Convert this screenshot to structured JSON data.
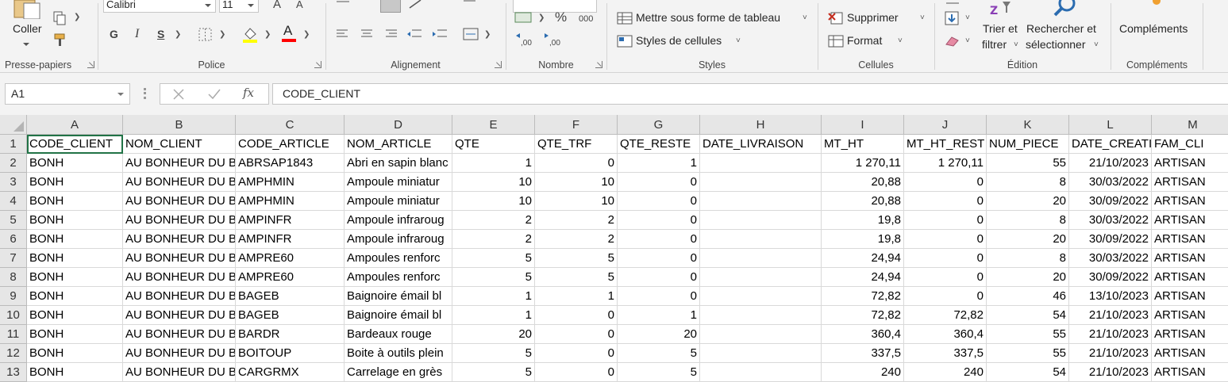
{
  "ribbon": {
    "clipboard": {
      "paste_label": "Coller",
      "group_label": "Presse-papiers"
    },
    "font": {
      "name": "Calibri",
      "size": "11",
      "bold": "G",
      "italic": "I",
      "underline": "S",
      "group_label": "Police",
      "fill_color": "#ffff00",
      "text_color": "#ff0000"
    },
    "alignment": {
      "group_label": "Alignement"
    },
    "number": {
      "percent": "%",
      "thousands": "000",
      "inc_decimal": ",00",
      "dec_decimal": ",00",
      "group_label": "Nombre"
    },
    "styles": {
      "format_as_table": "Mettre sous forme de tableau",
      "cell_styles": "Styles de cellules",
      "group_label": "Styles"
    },
    "cells": {
      "delete": "Supprimer",
      "format": "Format",
      "group_label": "Cellules"
    },
    "editing": {
      "sort_filter_line1": "Trier et",
      "sort_filter_line2": "filtrer",
      "find_select_line1": "Rechercher et",
      "find_select_line2": "sélectionner",
      "group_label": "Édition"
    },
    "addins": {
      "label": "Compléments",
      "group_label": "Compléments"
    }
  },
  "formula_bar": {
    "name_box": "A1",
    "fx": "fx",
    "content": "CODE_CLIENT"
  },
  "columns": [
    "A",
    "B",
    "C",
    "D",
    "E",
    "F",
    "G",
    "H",
    "I",
    "J",
    "K",
    "L",
    "M"
  ],
  "rows": [
    {
      "n": "1",
      "cells": [
        "CODE_CLIENT",
        "NOM_CLIENT",
        "CODE_ARTICLE",
        "NOM_ARTICLE",
        "QTE",
        "QTE_TRF",
        "QTE_RESTE",
        "DATE_LIVRAISON",
        "MT_HT",
        "MT_HT_REST",
        "NUM_PIECE",
        "DATE_CREATI",
        "FAM_CLI"
      ]
    },
    {
      "n": "2",
      "cells": [
        "BONH",
        "AU BONHEUR DU B",
        "ABRSAP1843",
        "Abri en sapin blanc",
        "1",
        "0",
        "1",
        "",
        "1 270,11",
        "1 270,11",
        "55",
        "21/10/2023",
        "ARTISAN"
      ]
    },
    {
      "n": "3",
      "cells": [
        "BONH",
        "AU BONHEUR DU B",
        "AMPHMIN",
        "Ampoule miniatur",
        "10",
        "10",
        "0",
        "",
        "20,88",
        "0",
        "8",
        "30/03/2022",
        "ARTISAN"
      ]
    },
    {
      "n": "4",
      "cells": [
        "BONH",
        "AU BONHEUR DU B",
        "AMPHMIN",
        "Ampoule miniatur",
        "10",
        "10",
        "0",
        "",
        "20,88",
        "0",
        "20",
        "30/09/2022",
        "ARTISAN"
      ]
    },
    {
      "n": "5",
      "cells": [
        "BONH",
        "AU BONHEUR DU B",
        "AMPINFR",
        "Ampoule infraroug",
        "2",
        "2",
        "0",
        "",
        "19,8",
        "0",
        "8",
        "30/03/2022",
        "ARTISAN"
      ]
    },
    {
      "n": "6",
      "cells": [
        "BONH",
        "AU BONHEUR DU B",
        "AMPINFR",
        "Ampoule infraroug",
        "2",
        "2",
        "0",
        "",
        "19,8",
        "0",
        "20",
        "30/09/2022",
        "ARTISAN"
      ]
    },
    {
      "n": "7",
      "cells": [
        "BONH",
        "AU BONHEUR DU B",
        "AMPRE60",
        "Ampoules renforc",
        "5",
        "5",
        "0",
        "",
        "24,94",
        "0",
        "8",
        "30/03/2022",
        "ARTISAN"
      ]
    },
    {
      "n": "8",
      "cells": [
        "BONH",
        "AU BONHEUR DU B",
        "AMPRE60",
        "Ampoules renforc",
        "5",
        "5",
        "0",
        "",
        "24,94",
        "0",
        "20",
        "30/09/2022",
        "ARTISAN"
      ]
    },
    {
      "n": "9",
      "cells": [
        "BONH",
        "AU BONHEUR DU B",
        "BAGEB",
        "Baignoire émail bl",
        "1",
        "1",
        "0",
        "",
        "72,82",
        "0",
        "46",
        "13/10/2023",
        "ARTISAN"
      ]
    },
    {
      "n": "10",
      "cells": [
        "BONH",
        "AU BONHEUR DU B",
        "BAGEB",
        "Baignoire émail bl",
        "1",
        "0",
        "1",
        "",
        "72,82",
        "72,82",
        "54",
        "21/10/2023",
        "ARTISAN"
      ]
    },
    {
      "n": "11",
      "cells": [
        "BONH",
        "AU BONHEUR DU B",
        "BARDR",
        "Bardeaux rouge",
        "20",
        "0",
        "20",
        "",
        "360,4",
        "360,4",
        "55",
        "21/10/2023",
        "ARTISAN"
      ]
    },
    {
      "n": "12",
      "cells": [
        "BONH",
        "AU BONHEUR DU B",
        "BOITOUP",
        "Boite à outils plein",
        "5",
        "0",
        "5",
        "",
        "337,5",
        "337,5",
        "55",
        "21/10/2023",
        "ARTISAN"
      ]
    },
    {
      "n": "13",
      "cells": [
        "BONH",
        "AU BONHEUR DU B",
        "CARGRMX",
        "Carrelage en grès",
        "5",
        "0",
        "5",
        "",
        "240",
        "240",
        "54",
        "21/10/2023",
        "ARTISAN"
      ]
    }
  ]
}
